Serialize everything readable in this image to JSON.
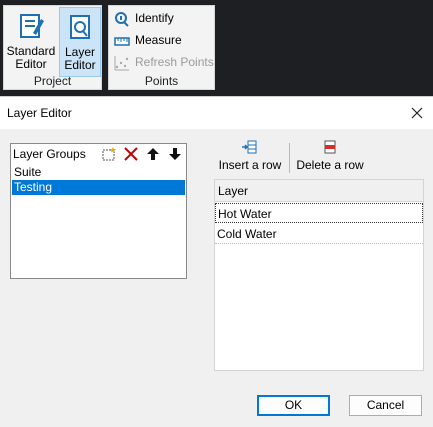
{
  "ribbon": {
    "project": {
      "label": "Project",
      "standard_editor": "Standard\nEditor",
      "layer_editor": "Layer\nEditor"
    },
    "points": {
      "label": "Points",
      "identify": "Identify",
      "measure": "Measure",
      "refresh_points": "Refresh Points"
    }
  },
  "dialog": {
    "title": "Layer Editor",
    "layer_groups": {
      "title": "Layer Groups",
      "items": [
        "Suite",
        "Testing"
      ],
      "selected": "Testing"
    },
    "insert_row": "Insert a row",
    "delete_row": "Delete a row",
    "grid": {
      "header": "Layer",
      "rows": [
        "Hot Water",
        "Cold Water"
      ]
    },
    "ok": "OK",
    "cancel": "Cancel"
  },
  "colors": {
    "accent": "#0078d7",
    "ribbon_bg": "#f3f3f3",
    "selected_bg": "#cce4f7"
  }
}
